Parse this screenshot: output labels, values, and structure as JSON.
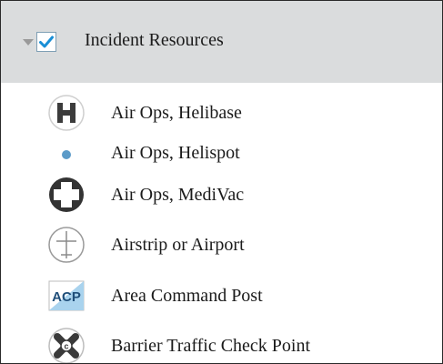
{
  "group": {
    "label": "Incident Resources",
    "checked": true,
    "expanded": true
  },
  "items": [
    {
      "label": "Air Ops, Helibase",
      "icon": "helibase-icon"
    },
    {
      "label": "Air Ops, Helispot",
      "icon": "helispot-icon"
    },
    {
      "label": "Air Ops, MediVac",
      "icon": "medivac-icon"
    },
    {
      "label": "Airstrip or Airport",
      "icon": "airstrip-icon"
    },
    {
      "label": "Area Command Post",
      "icon": "area-command-post-icon",
      "icon_text": "ACP"
    },
    {
      "label": "Barrier Traffic Check Point",
      "icon": "barrier-traffic-check-point-icon"
    }
  ],
  "colors": {
    "header_bg": "#dadcdd",
    "checkmark": "#1a8fd6",
    "helispot_dot": "#5b9bc8",
    "acp_text": "#1f4e79",
    "acp_fill": "#a9d3ee"
  }
}
